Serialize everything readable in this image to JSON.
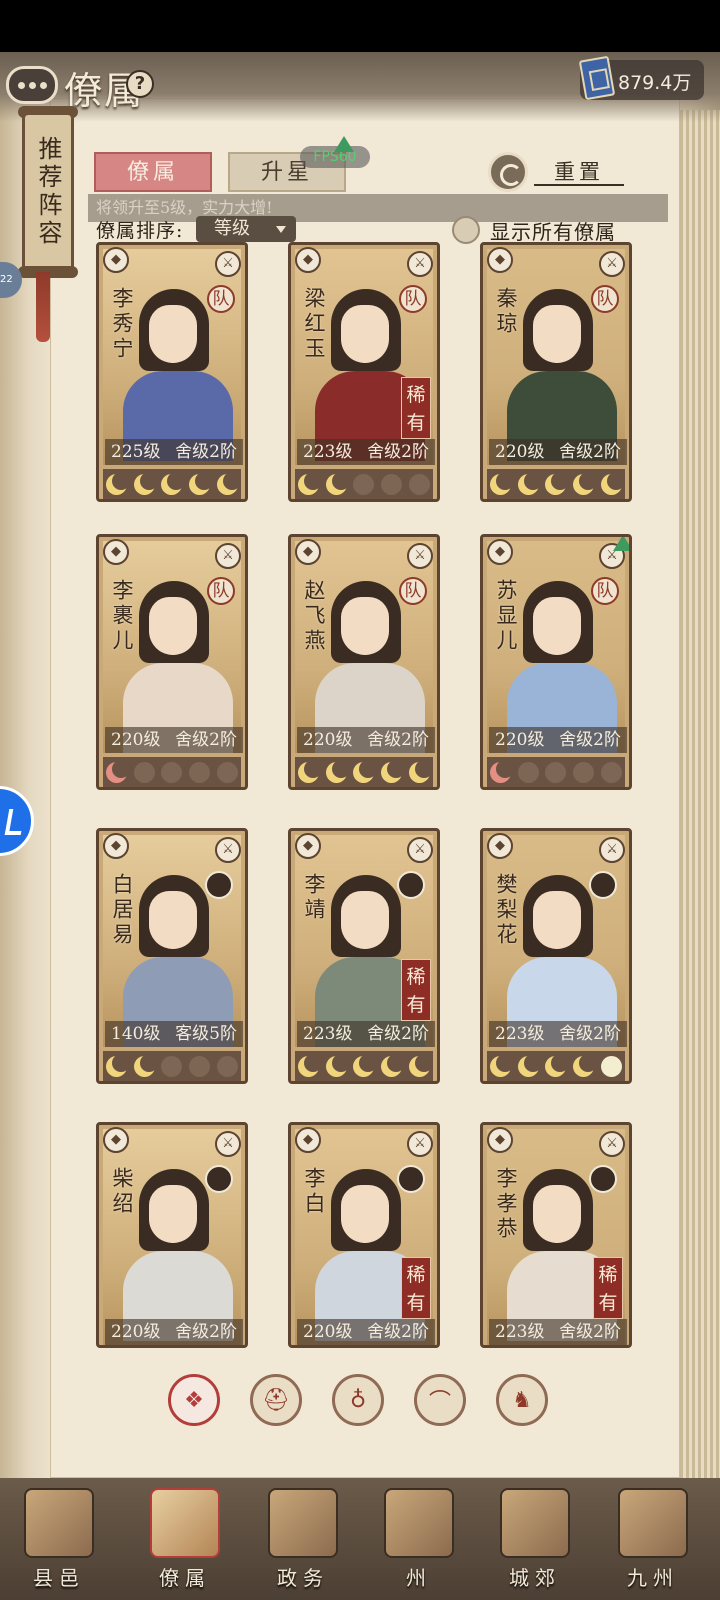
{
  "header": {
    "title": "僚属",
    "coin_value": "879.4万"
  },
  "recommend": {
    "label": "推荐阵容"
  },
  "side_badge": "22",
  "tabs": [
    {
      "label": "僚属",
      "active": true
    },
    {
      "label": "升星",
      "active": false
    }
  ],
  "fps": "FPS60",
  "reset": {
    "label": "重置"
  },
  "banner": "将领升至5级，实力大增!",
  "sort": {
    "label": "僚属排序:",
    "value": "等级"
  },
  "show_all": {
    "label": "显示所有僚属"
  },
  "cards": [
    {
      "name": "李秀宁",
      "level": "225级",
      "rank": "舍级2阶",
      "rare": false,
      "team": true,
      "moons": [
        "full",
        "full",
        "full",
        "full",
        "full"
      ],
      "robe": "#5a6aa8",
      "up": false
    },
    {
      "name": "梁红玉",
      "level": "223级",
      "rank": "舍级2阶",
      "rare": true,
      "team": true,
      "moons": [
        "full",
        "full",
        "empty",
        "empty",
        "empty"
      ],
      "robe": "#8a2d2a",
      "up": false
    },
    {
      "name": "秦琼",
      "level": "220级",
      "rank": "舍级2阶",
      "rare": false,
      "team": true,
      "moons": [
        "full",
        "full",
        "full",
        "full",
        "full"
      ],
      "robe": "#3e4c3a",
      "up": false
    },
    {
      "name": "李裹儿",
      "level": "220级",
      "rank": "舍级2阶",
      "rare": false,
      "team": true,
      "moons": [
        "red",
        "empty",
        "empty",
        "empty",
        "empty"
      ],
      "robe": "#e8d8c8",
      "up": false
    },
    {
      "name": "赵飞燕",
      "level": "220级",
      "rank": "舍级2阶",
      "rare": false,
      "team": true,
      "moons": [
        "full",
        "full",
        "full",
        "full",
        "full"
      ],
      "robe": "#dcd4c8",
      "up": false
    },
    {
      "name": "苏显儿",
      "level": "220级",
      "rank": "舍级2阶",
      "rare": false,
      "team": true,
      "moons": [
        "red",
        "empty",
        "empty",
        "empty",
        "empty"
      ],
      "robe": "#9ab4d8",
      "up": true
    },
    {
      "name": "白居易",
      "level": "140级",
      "rank": "客级5阶",
      "rare": false,
      "team": false,
      "moons": [
        "full",
        "full",
        "empty",
        "empty",
        "empty"
      ],
      "robe": "#8f9cb6",
      "up": false
    },
    {
      "name": "李靖",
      "level": "223级",
      "rank": "舍级2阶",
      "rare": true,
      "team": false,
      "moons": [
        "full",
        "full",
        "full",
        "full",
        "full"
      ],
      "robe": "#7d8a7a",
      "up": false
    },
    {
      "name": "樊梨花",
      "level": "223级",
      "rank": "舍级2阶",
      "rare": false,
      "team": false,
      "moons": [
        "full",
        "full",
        "full",
        "full",
        "white"
      ],
      "robe": "#c8d8ea",
      "up": false
    },
    {
      "name": "柴绍",
      "level": "220级",
      "rank": "舍级2阶",
      "rare": false,
      "team": false,
      "moons": [],
      "robe": "#dcdad4",
      "up": false
    },
    {
      "name": "李白",
      "level": "220级",
      "rank": "舍级2阶",
      "rare": true,
      "team": false,
      "moons": [],
      "robe": "#cfd6de",
      "up": false
    },
    {
      "name": "李孝恭",
      "level": "223级",
      "rank": "舍级2阶",
      "rare": true,
      "team": false,
      "moons": [],
      "robe": "#e6dcd0",
      "up": false
    }
  ],
  "card_labels": {
    "team": "队",
    "rare": "稀有"
  },
  "filters": [
    {
      "icon": "diamond-icon",
      "active": true
    },
    {
      "icon": "helmet-icon",
      "active": false
    },
    {
      "icon": "gourd-icon",
      "active": false
    },
    {
      "icon": "fan-icon",
      "active": false
    },
    {
      "icon": "lion-icon",
      "active": false
    }
  ],
  "nav": [
    {
      "label": "县邑",
      "active": false
    },
    {
      "label": "僚属",
      "active": true
    },
    {
      "label": "政务",
      "active": false
    },
    {
      "label": "州",
      "active": false
    },
    {
      "label": "城郊",
      "active": false
    },
    {
      "label": "九州",
      "active": false
    }
  ],
  "colors": {
    "tab_active": "#d68785",
    "rare_bg": "#8e2d25",
    "moon": "#f1d57c"
  }
}
